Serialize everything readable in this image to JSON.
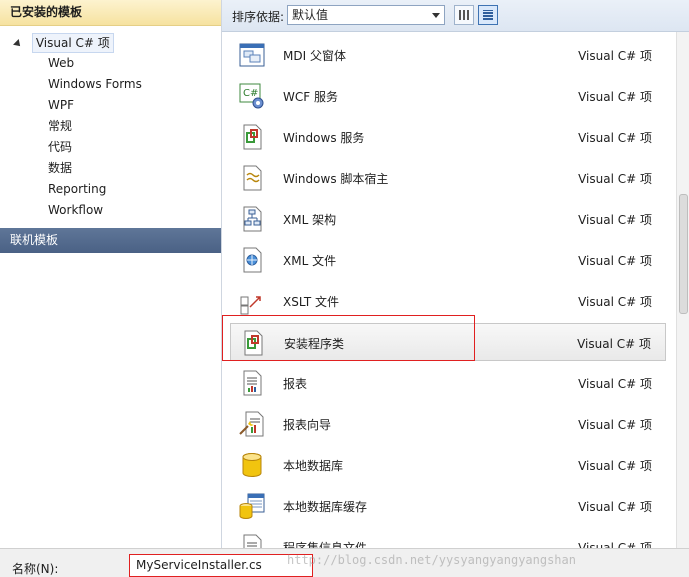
{
  "left_panel": {
    "header": "已安装的模板",
    "root_item": "Visual C# 项",
    "children": [
      "Web",
      "Windows Forms",
      "WPF",
      "常规",
      "代码",
      "数据",
      "Reporting",
      "Workflow"
    ],
    "online_templates": "联机模板"
  },
  "toolbar": {
    "sort_label": "排序依据:",
    "sort_value": "默认值"
  },
  "templates": [
    {
      "name": "MDI 父窗体",
      "lang": "Visual C# 项",
      "icon": "mdi-form-icon"
    },
    {
      "name": "WCF 服务",
      "lang": "Visual C# 项",
      "icon": "wcf-service-icon"
    },
    {
      "name": "Windows 服务",
      "lang": "Visual C# 项",
      "icon": "windows-service-icon"
    },
    {
      "name": "Windows 脚本宿主",
      "lang": "Visual C# 项",
      "icon": "script-host-icon"
    },
    {
      "name": "XML 架构",
      "lang": "Visual C# 项",
      "icon": "xml-schema-icon"
    },
    {
      "name": "XML 文件",
      "lang": "Visual C# 项",
      "icon": "xml-file-icon"
    },
    {
      "name": "XSLT 文件",
      "lang": "Visual C# 项",
      "icon": "xslt-file-icon"
    },
    {
      "name": "安装程序类",
      "lang": "Visual C# 项",
      "icon": "installer-class-icon"
    },
    {
      "name": "报表",
      "lang": "Visual C# 项",
      "icon": "report-icon"
    },
    {
      "name": "报表向导",
      "lang": "Visual C# 项",
      "icon": "report-wizard-icon"
    },
    {
      "name": "本地数据库",
      "lang": "Visual C# 项",
      "icon": "local-database-icon"
    },
    {
      "name": "本地数据库缓存",
      "lang": "Visual C# 项",
      "icon": "local-database-cache-icon"
    },
    {
      "name": "程序集信息文件",
      "lang": "Visual C# 项",
      "icon": "assembly-info-icon"
    }
  ],
  "selected_index": 7,
  "bottom": {
    "name_label": "名称(N):",
    "name_value": "MyServiceInstaller.cs"
  },
  "watermark": "http://blog.csdn.net/yysyangyangyangshan",
  "colors": {
    "header_gold": "#f6e2a0",
    "online_blue": "#4a6185",
    "highlight_red": "#e02020"
  }
}
